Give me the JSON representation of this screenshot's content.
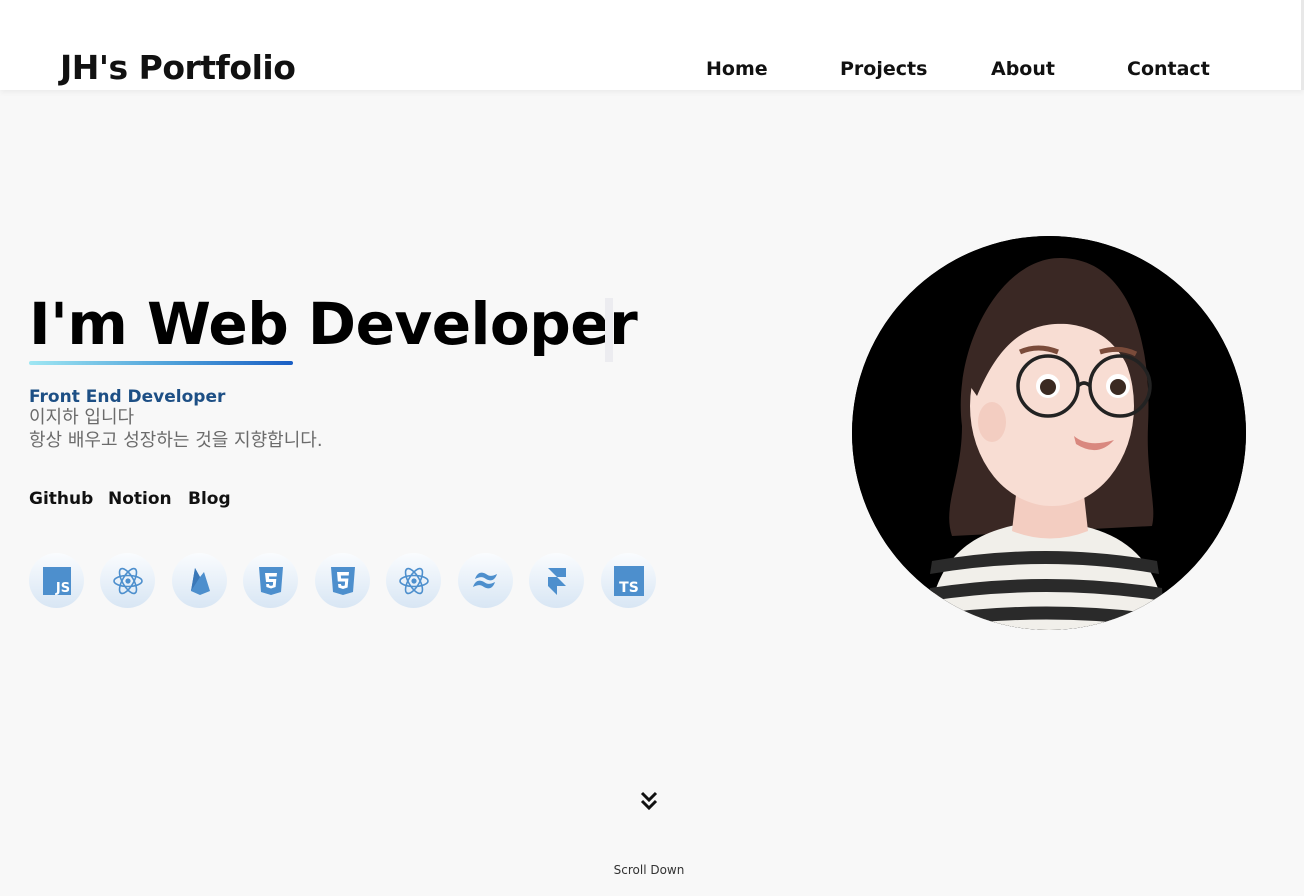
{
  "header": {
    "logo": "JH's Portfolio",
    "nav": [
      "Home",
      "Projects",
      "About",
      "Contact"
    ]
  },
  "hero": {
    "title": "I'm Web Developer",
    "role": "Front End Developer",
    "intro_line1": "이지하 입니다",
    "intro_line2": "항상 배우고 성장하는 것을 지향합니다.",
    "links": [
      "Github",
      "Notion",
      "Blog"
    ],
    "tech_icons": [
      "javascript-icon",
      "react-icon",
      "firebase-icon",
      "css3-icon",
      "html5-icon",
      "react-icon",
      "tailwind-icon",
      "framer-icon",
      "typescript-icon"
    ],
    "tech_icon_text": {
      "javascript": "JS",
      "typescript": "TS"
    },
    "underline_gradient": [
      "#9fe7f3",
      "#1a5ec4"
    ]
  },
  "scroll": {
    "label": "Scroll Down"
  },
  "colors": {
    "accent": "#1d4f85",
    "icon_blue": "#4d8fcd",
    "background": "#f8f8f8"
  }
}
